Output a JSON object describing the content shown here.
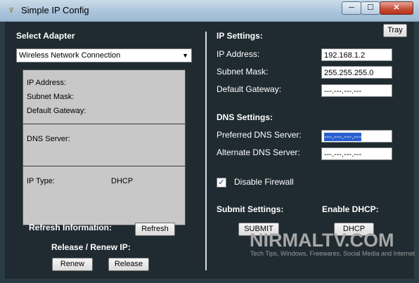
{
  "window": {
    "title": "Simple IP Config",
    "min": "─",
    "max": "☐",
    "close": "✕"
  },
  "left": {
    "select_adapter_label": "Select Adapter",
    "adapter_selected": "Wireless Network Connection",
    "info": {
      "ip_address_label": "IP Address:",
      "subnet_mask_label": "Subnet Mask:",
      "default_gateway_label": "Default Gateway:",
      "dns_server_label": "DNS Server:",
      "ip_type_label": "IP Type:",
      "ip_type_value": "DHCP"
    },
    "refresh_label": "Refresh Information:",
    "refresh_button": "Refresh",
    "release_renew_label": "Release / Renew IP:",
    "renew_button": "Renew",
    "release_button": "Release"
  },
  "right": {
    "tray_button": "Tray",
    "ip_settings_title": "IP Settings:",
    "ip_address_label": "IP Address:",
    "ip_address_value": "192.168.1.2",
    "subnet_mask_label": "Subnet Mask:",
    "subnet_mask_value": "255.255.255.0",
    "default_gateway_label": "Default Gateway:",
    "default_gateway_value": "---.---.---.---",
    "dns_settings_title": "DNS Settings:",
    "preferred_dns_label": "Preferred DNS Server:",
    "preferred_dns_value": "---.---.---.---",
    "alternate_dns_label": "Alternate DNS Server:",
    "alternate_dns_value": "---.---.---.---",
    "disable_firewall_label": "Disable Firewall",
    "disable_firewall_checked": true,
    "submit_settings_label": "Submit Settings:",
    "submit_button": "SUBMIT",
    "enable_dhcp_label": "Enable DHCP:",
    "dhcp_button": "DHCP"
  },
  "watermark": {
    "brand": "NIRMALTV.COM",
    "tagline": "Tech Tips, Windows, Freewares, Social Media and Internet"
  }
}
